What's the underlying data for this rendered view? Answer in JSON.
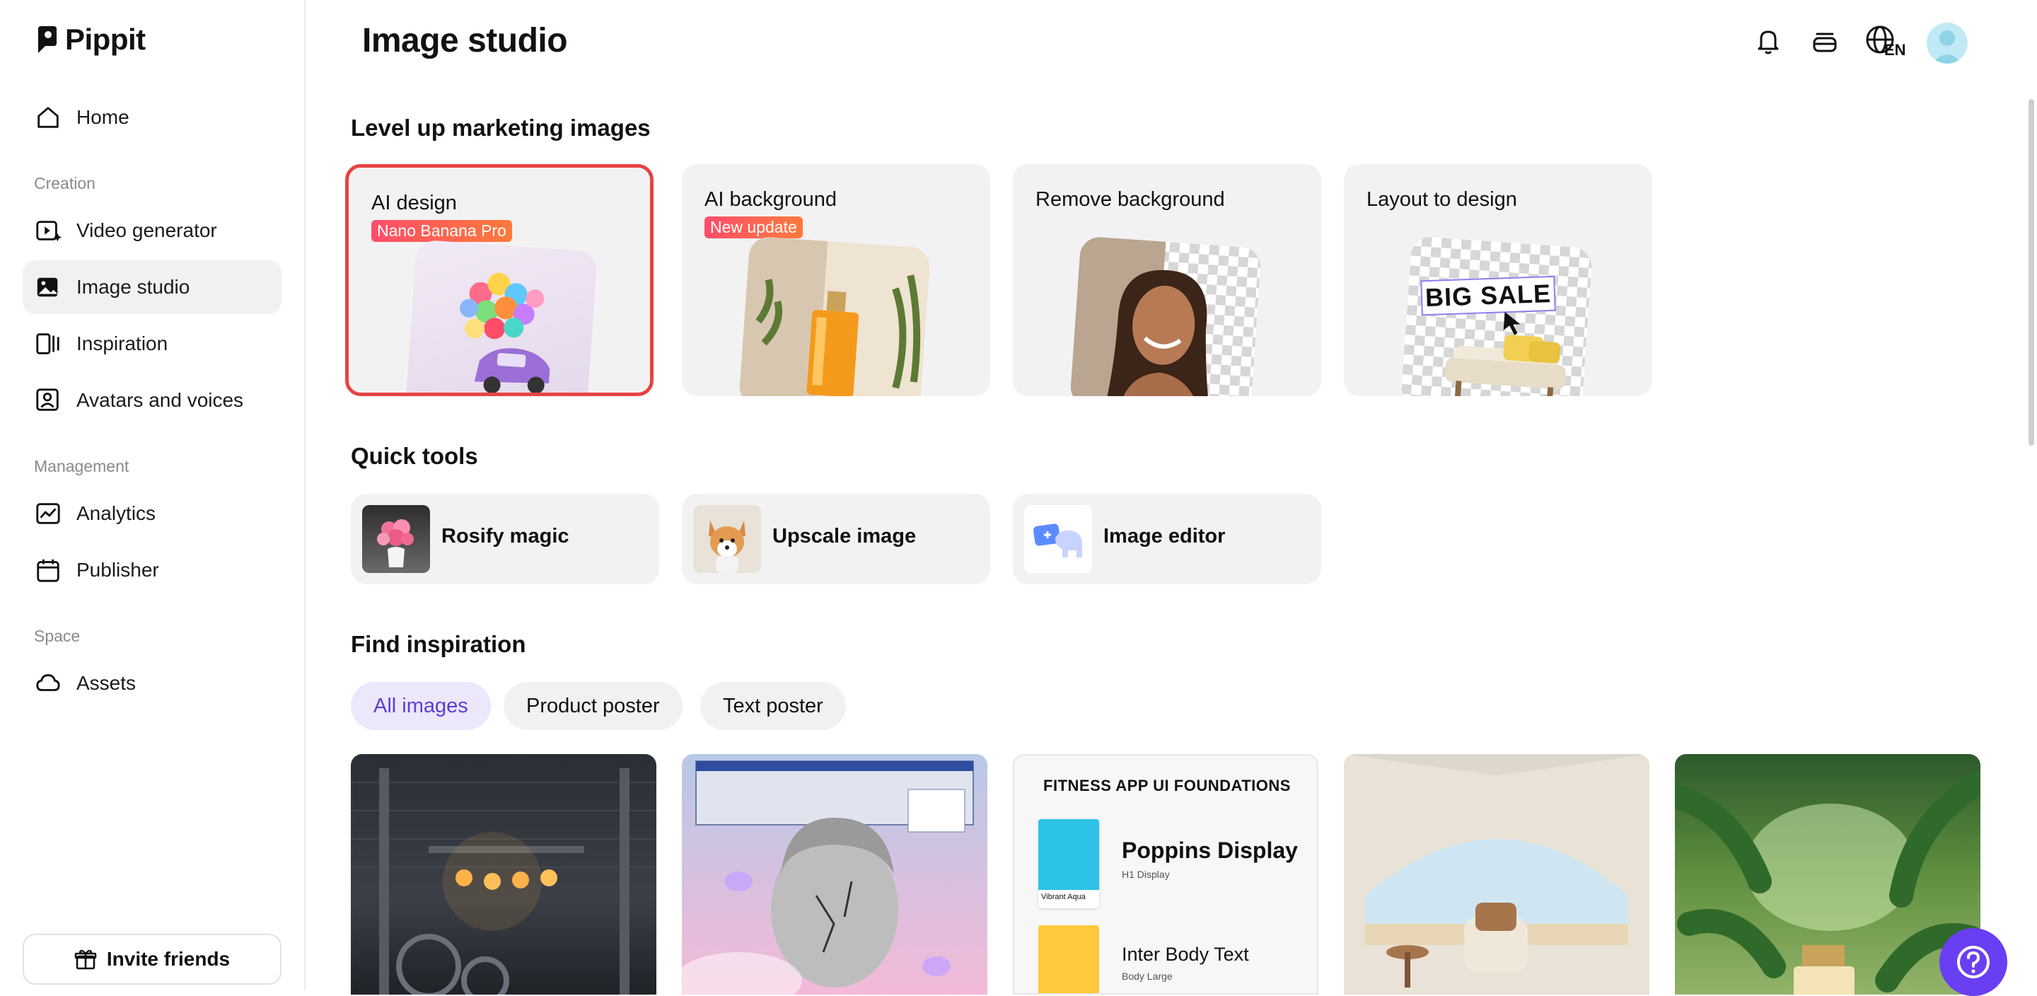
{
  "brand": {
    "name": "Pippit"
  },
  "sidebar": {
    "home": "Home",
    "sections": {
      "creation": "Creation",
      "management": "Management",
      "space": "Space"
    },
    "items": [
      {
        "label": "Video generator"
      },
      {
        "label": "Image studio"
      },
      {
        "label": "Inspiration"
      },
      {
        "label": "Avatars and voices"
      },
      {
        "label": "Analytics"
      },
      {
        "label": "Publisher"
      },
      {
        "label": "Assets"
      }
    ],
    "invite_label": "Invite friends"
  },
  "header": {
    "title": "Image studio",
    "language": "EN"
  },
  "marketing": {
    "heading": "Level up marketing images",
    "cards": [
      {
        "title": "AI design",
        "badge": "Nano Banana Pro"
      },
      {
        "title": "AI background",
        "badge": "New update"
      },
      {
        "title": "Remove background"
      },
      {
        "title": "Layout to design",
        "thumb_text": "BIG SALE"
      }
    ]
  },
  "quick_tools": {
    "heading": "Quick tools",
    "items": [
      {
        "label": "Rosify magic"
      },
      {
        "label": "Upscale image"
      },
      {
        "label": "Image editor"
      }
    ]
  },
  "inspiration": {
    "heading": "Find inspiration",
    "filters": [
      {
        "label": "All images"
      },
      {
        "label": "Product poster"
      },
      {
        "label": "Text poster"
      }
    ],
    "fitness_card": {
      "title": "FITNESS APP UI FOUNDATIONS",
      "swatch1_label": "Vibrant Aqua",
      "font1": "Poppins Display",
      "font1_sub": "H1 Display",
      "font2": "Inter Body Text",
      "font2_sub": "Body Large"
    }
  },
  "colors": {
    "accent": "#5b3fd6",
    "selected_border": "#e74343",
    "help": "#6a3ef2"
  }
}
